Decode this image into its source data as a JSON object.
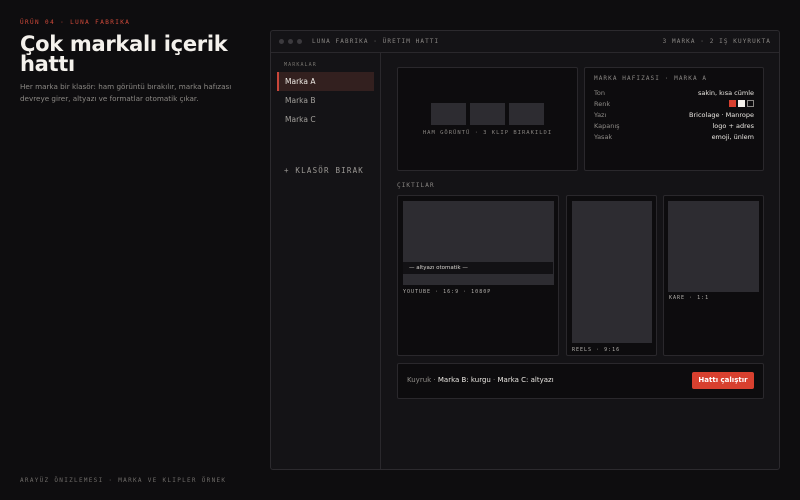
{
  "hero": {
    "eyebrow": "Ürün 04 · Luna Fabrika",
    "title": "Çok markalı içerik hattı",
    "description": "Her marka bir klasör: ham görüntü bırakılır, marka hafızası devreye girer, altyazı ve formatlar otomatik çıkar."
  },
  "footer": {
    "note": "Arayüz önizlemesi · marka ve klipler örnek"
  },
  "window": {
    "title": "Luna Fabrika · Üretim Hattı",
    "status": "3 marka · 2 iş kuyrukta"
  },
  "sidebar": {
    "heading": "Markalar",
    "items": [
      {
        "label": "Marka A"
      },
      {
        "label": "Marka B"
      },
      {
        "label": "Marka C"
      }
    ],
    "add_label": "+ Klasör bırak"
  },
  "raw": {
    "label": "Ham görüntü · 3 klip bırakıldı"
  },
  "memory": {
    "title": "Marka hafızası · Marka A",
    "rows": [
      {
        "key": "Ton",
        "value": "sakin, kısa cümle"
      },
      {
        "key": "Renk",
        "value": ""
      },
      {
        "key": "Yazı",
        "value": "Bricolage · Manrope"
      },
      {
        "key": "Kapanış",
        "value": "logo + adres"
      },
      {
        "key": "Yasak",
        "value": "emoji, ünlem"
      }
    ],
    "swatches": [
      "#d8402f",
      "#f4f1ec",
      "#0d0c0e"
    ]
  },
  "outputs": {
    "section_label": "Çıktılar",
    "youtube": {
      "label": "YouTube · 16:9 · 1080p",
      "caption": "— altyazı otomatik —"
    },
    "reels": {
      "label": "Reels · 9:16"
    },
    "square": {
      "label": "Kare · 1:1"
    }
  },
  "queue": {
    "prefix": "Kuyruk · ",
    "b_item": "Marka B: kurgu",
    "separator": " · ",
    "c_item": "Marka C: altyazı"
  },
  "run_button": {
    "label": "Hattı çalıştır"
  },
  "colors": {
    "accent": "#d8402f",
    "background": "#0e0d0f",
    "panel": "#0d0c0e"
  }
}
